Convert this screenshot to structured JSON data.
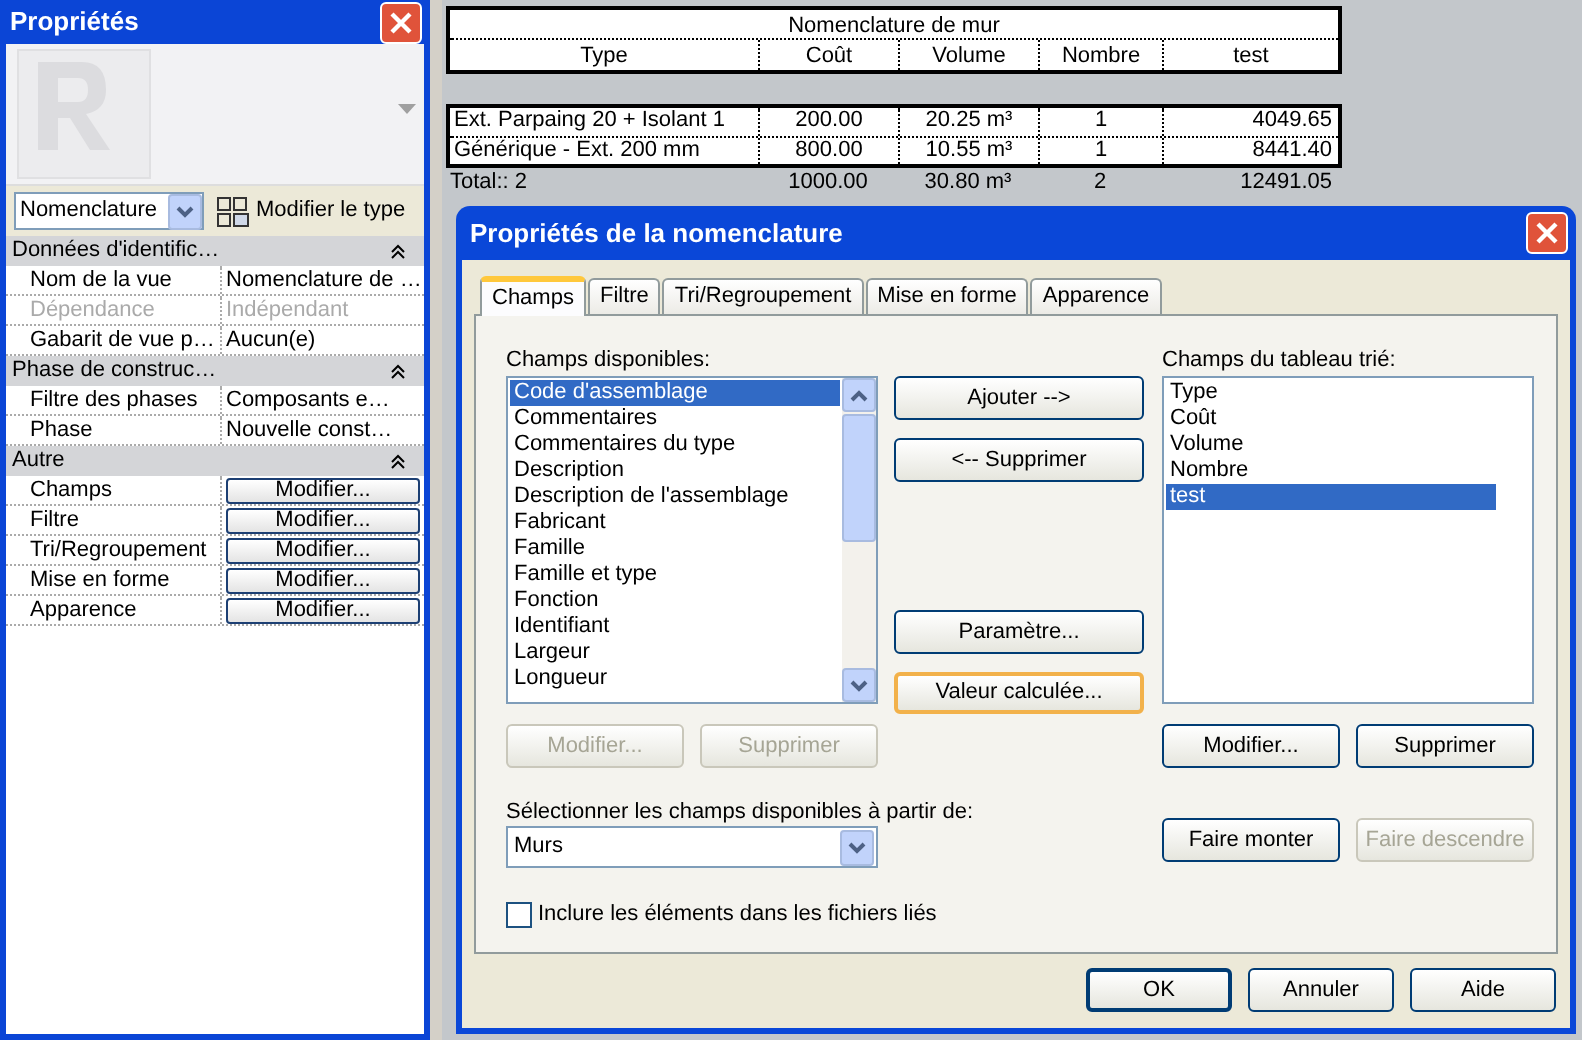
{
  "properties_panel": {
    "title": "Propriétés",
    "type_selector": {
      "value": "Nomenclature"
    },
    "edit_type_button": "Modifier le type",
    "groups": [
      {
        "label": "Données d'identific…",
        "expanded": true,
        "rows": [
          {
            "kind": "text",
            "label": "Nom de la vue",
            "value": "Nomenclature de …",
            "disabled": false
          },
          {
            "kind": "text",
            "label": "Dépendance",
            "value": "Indépendant",
            "disabled": true
          },
          {
            "kind": "text",
            "label": "Gabarit de vue p…",
            "value": "Aucun(e)",
            "disabled": false
          }
        ]
      },
      {
        "label": "Phase de construc…",
        "expanded": true,
        "rows": [
          {
            "kind": "text",
            "label": "Filtre des phases",
            "value": "Composants e…",
            "disabled": false
          },
          {
            "kind": "text",
            "label": "Phase",
            "value": "Nouvelle const…",
            "disabled": false
          }
        ]
      },
      {
        "label": "Autre",
        "expanded": true,
        "rows": [
          {
            "kind": "button",
            "label": "Champs",
            "value": "Modifier...",
            "disabled": false
          },
          {
            "kind": "button",
            "label": "Filtre",
            "value": "Modifier...",
            "disabled": false
          },
          {
            "kind": "button",
            "label": "Tri/Regroupement",
            "value": "Modifier...",
            "disabled": false
          },
          {
            "kind": "button",
            "label": "Mise en forme",
            "value": "Modifier...",
            "disabled": false
          },
          {
            "kind": "button",
            "label": "Apparence",
            "value": "Modifier...",
            "disabled": false
          }
        ]
      }
    ]
  },
  "schedule": {
    "title": "Nomenclature de mur",
    "columns": [
      "Type",
      "Coût",
      "Volume",
      "Nombre",
      "test"
    ],
    "rows": [
      [
        "Ext. Parpaing 20 + Isolant 1",
        "200.00",
        "20.25 m³",
        "1",
        "4049.65"
      ],
      [
        "Générique - Ext. 200 mm",
        "800.00",
        "10.55 m³",
        "1",
        "8441.40"
      ]
    ],
    "total": [
      "Total:: 2",
      "1000.00",
      "30.80 m³",
      "2",
      "12491.05"
    ]
  },
  "dialog": {
    "title": "Propriétés de la nomenclature",
    "tabs": [
      {
        "label": "Champs",
        "selected": true
      },
      {
        "label": "Filtre",
        "selected": false
      },
      {
        "label": "Tri/Regroupement",
        "selected": false
      },
      {
        "label": "Mise en forme",
        "selected": false
      },
      {
        "label": "Apparence",
        "selected": false
      }
    ],
    "available_label": "Champs disponibles:",
    "available_fields": [
      {
        "label": "Code d'assemblage",
        "selected": true
      },
      {
        "label": "Commentaires",
        "selected": false
      },
      {
        "label": "Commentaires du type",
        "selected": false
      },
      {
        "label": "Description",
        "selected": false
      },
      {
        "label": "Description de l'assemblage",
        "selected": false
      },
      {
        "label": "Fabricant",
        "selected": false
      },
      {
        "label": "Famille",
        "selected": false
      },
      {
        "label": "Famille et type",
        "selected": false
      },
      {
        "label": "Fonction",
        "selected": false
      },
      {
        "label": "Identifiant",
        "selected": false
      },
      {
        "label": "Largeur",
        "selected": false
      },
      {
        "label": "Longueur",
        "selected": false
      }
    ],
    "add_button": "Ajouter -->",
    "remove_button": "<-- Supprimer",
    "parameter_button": "Paramètre...",
    "calculated_button": "Valeur calculée...",
    "scheduled_label": "Champs du tableau trié:",
    "scheduled_fields": [
      {
        "label": "Type",
        "selected": false
      },
      {
        "label": "Coût",
        "selected": false
      },
      {
        "label": "Volume",
        "selected": false
      },
      {
        "label": "Nombre",
        "selected": false
      },
      {
        "label": "test",
        "selected": true
      }
    ],
    "left_buttons": [
      {
        "label": "Modifier...",
        "disabled": true
      },
      {
        "label": "Supprimer",
        "disabled": true
      }
    ],
    "right_buttons": [
      {
        "label": "Modifier...",
        "disabled": false
      },
      {
        "label": "Supprimer",
        "disabled": false
      }
    ],
    "source_label": "Sélectionner les champs disponibles à partir de:",
    "source_value": "Murs",
    "order_buttons": [
      {
        "label": "Faire monter",
        "disabled": false
      },
      {
        "label": "Faire descendre",
        "disabled": true
      }
    ],
    "include_linked": {
      "label": "Inclure les éléments dans les fichiers liés",
      "checked": false
    },
    "footer_buttons": [
      "OK",
      "Annuler",
      "Aide"
    ]
  }
}
